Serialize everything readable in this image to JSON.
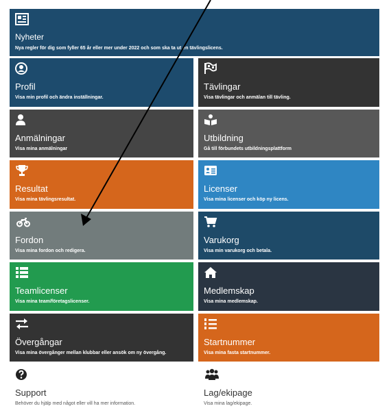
{
  "news": {
    "title": "Nyheter",
    "desc": "Nya regler för dig som fyller 65 år eller mer under 2022 och som ska ta ut en tävlingslicens."
  },
  "tiles": {
    "profil": {
      "title": "Profil",
      "desc": "Visa min profil och ändra inställningar."
    },
    "tavlingar": {
      "title": "Tävlingar",
      "desc": "Visa tävlingar och anmälan till tävling."
    },
    "anmalningar": {
      "title": "Anmälningar",
      "desc": "Visa mina anmälningar"
    },
    "utbildning": {
      "title": "Utbildning",
      "desc": "Gå till förbundets utbildningsplattform"
    },
    "resultat": {
      "title": "Resultat",
      "desc": "Visa mina tävlingsresultat."
    },
    "licenser": {
      "title": "Licenser",
      "desc": "Visa mina licenser och köp ny licens."
    },
    "fordon": {
      "title": "Fordon",
      "desc": "Visa mina fordon och redigera."
    },
    "varukorg": {
      "title": "Varukorg",
      "desc": "Visa min varukorg och betala."
    },
    "teamlicenser": {
      "title": "Teamlicenser",
      "desc": "Visa mina team/företagslicenser."
    },
    "medlemskap": {
      "title": "Medlemskap",
      "desc": "Visa mina medlemskap."
    },
    "overgangar": {
      "title": "Övergångar",
      "desc": "Visa mina övergånger mellan klubbar eller ansök om ny övergång."
    },
    "startnummer": {
      "title": "Startnummer",
      "desc": "Visa mina fasta startnummer."
    },
    "support": {
      "title": "Support",
      "desc": "Behöver du hjälp med något eller vill ha mer information."
    },
    "lag": {
      "title": "Lag/ekipage",
      "desc": "Visa mina lag/ekipage."
    }
  },
  "colors": {
    "dark_blue": "#1d4b6d",
    "charcoal": "#333333",
    "dark_gray": "#454545",
    "mid_gray": "#585858",
    "orange": "#d5661c",
    "light_blue": "#2f86c3",
    "slate": "#727c7c",
    "navy": "#1e4a68",
    "green": "#229b4f",
    "dark_slate": "#2a3542"
  },
  "icons": {
    "news": "newspaper-icon",
    "profil": "user-circle-icon",
    "tavlingar": "checkered-flag-icon",
    "anmalningar": "user-icon",
    "utbildning": "book-reader-icon",
    "resultat": "trophy-icon",
    "licenser": "id-card-icon",
    "fordon": "motorcycle-icon",
    "varukorg": "shopping-cart-icon",
    "teamlicenser": "list-icon",
    "medlemskap": "home-icon",
    "overgangar": "exchange-arrows-icon",
    "startnummer": "numbered-list-icon",
    "support": "question-circle-icon",
    "lag": "users-icon"
  }
}
